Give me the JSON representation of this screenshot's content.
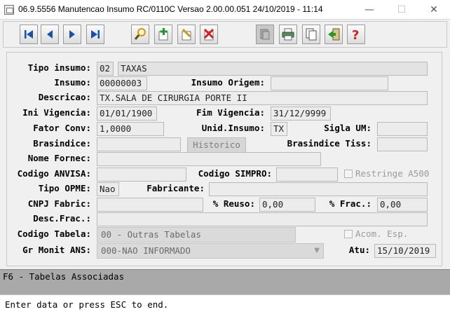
{
  "window": {
    "title": "06.9.5556 Manutencao  Insumo RC/0110C Versao 2.00.00.051 24/10/2019 - 11:14",
    "min_glyph": "—",
    "max_glyph": "☐",
    "close_glyph": "✕"
  },
  "toolbar": {
    "buttons": [
      {
        "name": "first-record-icon",
        "color": "#1c4fa8"
      },
      {
        "name": "previous-record-icon",
        "color": "#1c4fa8"
      },
      {
        "name": "next-record-icon",
        "color": "#1c4fa8"
      },
      {
        "name": "last-record-icon",
        "color": "#1c4fa8"
      },
      {
        "name": "search-icon",
        "color": "#c99a1a"
      },
      {
        "name": "add-record-icon",
        "color": "#1f9a2a"
      },
      {
        "name": "edit-record-icon",
        "color": "#c99a1a"
      },
      {
        "name": "delete-record-icon",
        "color": "#d02020"
      },
      {
        "name": "disabled-copy-icon",
        "color": "#8a8a8a"
      },
      {
        "name": "print-icon",
        "color": "#2a7a2a"
      },
      {
        "name": "duplicate-icon",
        "color": "#555555"
      },
      {
        "name": "exit-icon",
        "color": "#1f9a2a"
      },
      {
        "name": "help-icon",
        "color": "#d02020"
      }
    ]
  },
  "form": {
    "tipo_insumo": {
      "label": "Tipo insumo:",
      "code": "02",
      "desc": "TAXAS"
    },
    "insumo": {
      "label": "Insumo:",
      "value": "00000003"
    },
    "insumo_origem": {
      "label": "Insumo Origem:",
      "value": ""
    },
    "descricao": {
      "label": "Descricao:",
      "value": "TX.SALA DE CIRURGIA PORTE II"
    },
    "ini_vigencia": {
      "label": "Ini Vigencia:",
      "value": "01/01/1900"
    },
    "fim_vigencia": {
      "label": "Fim Vigencia:",
      "value": "31/12/9999"
    },
    "fator_conv": {
      "label": "Fator Conv:",
      "value": "1,0000"
    },
    "unid_insumo": {
      "label": "Unid.Insumo:",
      "value": "TX"
    },
    "sigla_um": {
      "label": "Sigla UM:",
      "value": ""
    },
    "brasindice": {
      "label": "Brasindice:",
      "value": ""
    },
    "historico_button": "Historico",
    "brasindice_tiss": {
      "label": "Brasindice Tiss:",
      "value": ""
    },
    "nome_fornec": {
      "label": "Nome Fornec:",
      "value": ""
    },
    "codigo_anvisa": {
      "label": "Codigo ANVISA:",
      "value": ""
    },
    "codigo_simpro": {
      "label": "Codigo SIMPRO:",
      "value": ""
    },
    "restringe_a500": {
      "label": "Restringe A500",
      "checked": false
    },
    "tipo_opme": {
      "label": "Tipo OPME:",
      "value": "Nao"
    },
    "fabricante": {
      "label": "Fabricante:",
      "value": ""
    },
    "cnpj_fabric": {
      "label": "CNPJ Fabric:",
      "value": ""
    },
    "pct_reuso": {
      "label": "% Reuso:",
      "value": "0,00"
    },
    "pct_frac": {
      "label": "% Frac.:",
      "value": "0,00"
    },
    "desc_frac": {
      "label": "Desc.Frac.:",
      "value": ""
    },
    "codigo_tabela": {
      "label": "Codigo Tabela:",
      "value": "00 - Outras Tabelas"
    },
    "acom_esp": {
      "label": "Acom. Esp.",
      "checked": false
    },
    "gr_monit_ans": {
      "label": "Gr Monit ANS:",
      "value": "000-NAO INFORMADO"
    },
    "atu": {
      "label": "Atu:",
      "value": "15/10/2019"
    }
  },
  "fkeys": "F6 - Tabelas Associadas",
  "status": "Enter data or press ESC to end."
}
